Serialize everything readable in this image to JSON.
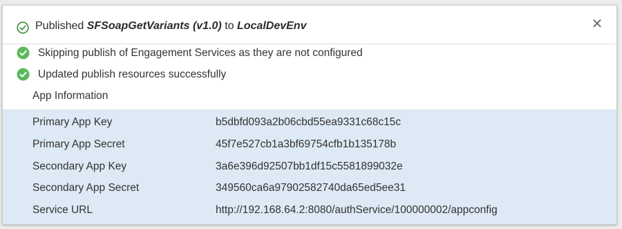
{
  "header": {
    "prefix": "Published ",
    "app_name": "SFSoapGetVariants (v1.0)",
    "middle": " to ",
    "environment": "LocalDevEnv",
    "close_icon": "close-icon"
  },
  "messages": [
    {
      "icon": "check-circle-icon",
      "text": "Skipping publish of Engagement Services as they are not configured"
    },
    {
      "icon": "check-circle-icon",
      "text": "Updated publish resources successfully"
    }
  ],
  "app_info": {
    "title": "App Information",
    "rows": [
      {
        "key": "Primary App Key",
        "value": "b5dbfd093a2b06cbd55ea9331c68c15c"
      },
      {
        "key": "Primary App Secret",
        "value": "45f7e527cb1a3bf69754cfb1b135178b"
      },
      {
        "key": "Secondary App Key",
        "value": "3a6e396d92507bb1df15c5581899032e"
      },
      {
        "key": "Secondary App Secret",
        "value": "349560ca6a97902582740da65ed5ee31"
      },
      {
        "key": "Service URL",
        "value": "http://192.168.64.2:8080/authService/100000002/appconfig"
      }
    ]
  },
  "colors": {
    "success_green": "#5cb85c",
    "header_check_green": "#3c8d3c",
    "table_background": "#dde9f4"
  }
}
